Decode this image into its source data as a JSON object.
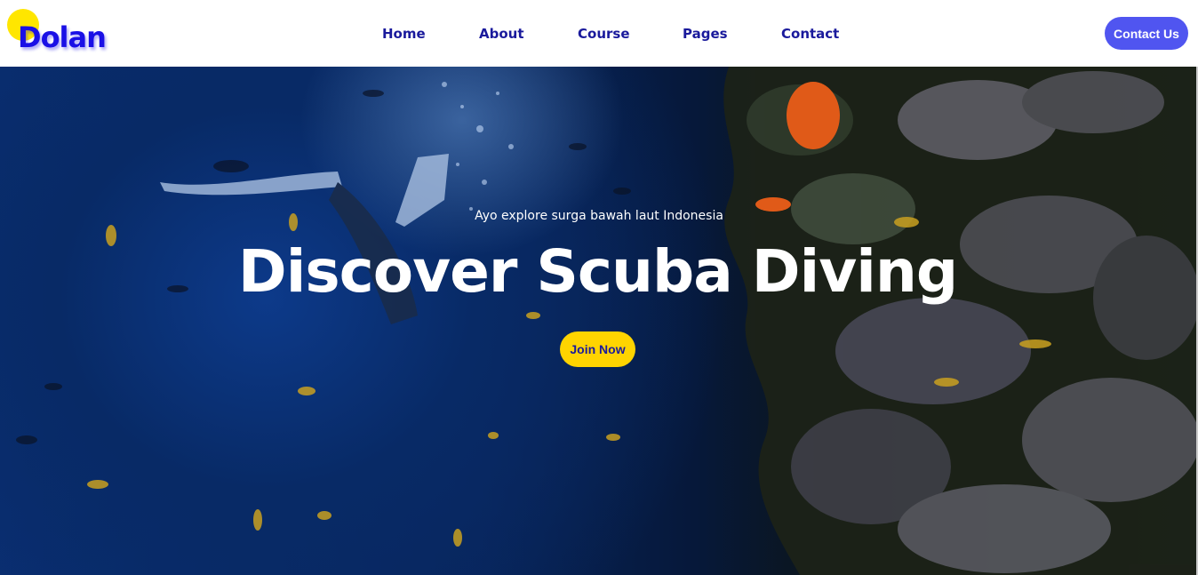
{
  "brand": {
    "name": "Dolan"
  },
  "nav": {
    "items": [
      {
        "label": "Home"
      },
      {
        "label": "About"
      },
      {
        "label": "Course"
      },
      {
        "label": "Pages"
      },
      {
        "label": "Contact"
      }
    ],
    "cta_label": "Contact Us"
  },
  "hero": {
    "subtitle": "Ayo explore surga bawah laut Indonesia",
    "title": "Discover Scuba Diving",
    "button_label": "Join Now"
  },
  "colors": {
    "brand_blue": "#1a10e6",
    "nav_text": "#1a1a9c",
    "cta_bg": "#5055f0",
    "join_bg": "#ffd400",
    "logo_dot": "#ffe600"
  }
}
